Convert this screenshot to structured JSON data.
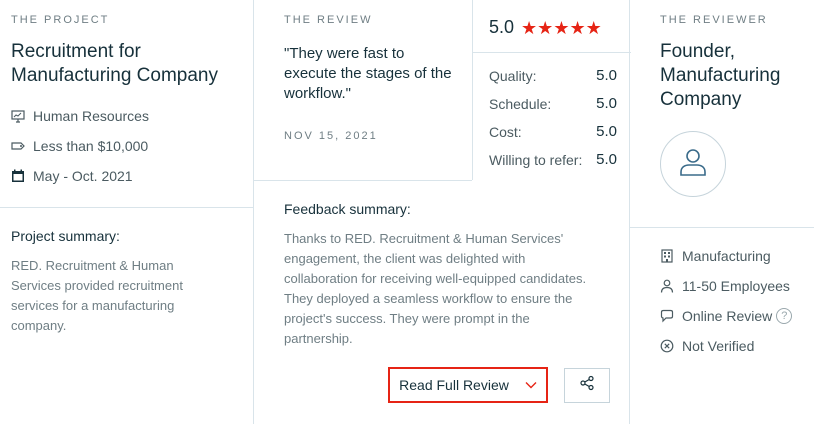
{
  "project": {
    "eyebrow": "THE PROJECT",
    "title": "Recruitment for Manufacturing Company",
    "service": "Human Resources",
    "budget": "Less than $10,000",
    "dates": "May - Oct. 2021",
    "summary_label": "Project summary:",
    "summary_text": "RED. Recruitment & Human Services provided recruitment services for a manufacturing company."
  },
  "review": {
    "eyebrow": "THE REVIEW",
    "quote": "\"They were fast to execute the stages of the workflow.\"",
    "date": "NOV 15, 2021",
    "overall": "5.0",
    "stars": 5,
    "ratings": [
      {
        "label": "Quality:",
        "value": "5.0"
      },
      {
        "label": "Schedule:",
        "value": "5.0"
      },
      {
        "label": "Cost:",
        "value": "5.0"
      },
      {
        "label": "Willing to refer:",
        "value": "5.0"
      }
    ],
    "feedback_label": "Feedback summary:",
    "feedback_text": "Thanks to RED. Recruitment & Human Services' engagement, the client was delighted with collaboration for receiving well-equipped candidates. They deployed a seamless workflow to ensure the project's success. They were prompt in the partnership.",
    "read_full_label": "Read Full Review"
  },
  "reviewer": {
    "eyebrow": "THE REVIEWER",
    "title": "Founder, Manufacturing Company",
    "industry": "Manufacturing",
    "size": "11-50 Employees",
    "review_type": "Online Review",
    "verification": "Not Verified"
  },
  "colors": {
    "accent": "#e62415",
    "text": "#17313b",
    "muted": "#6f7e84",
    "divider": "#d9e4ea"
  }
}
